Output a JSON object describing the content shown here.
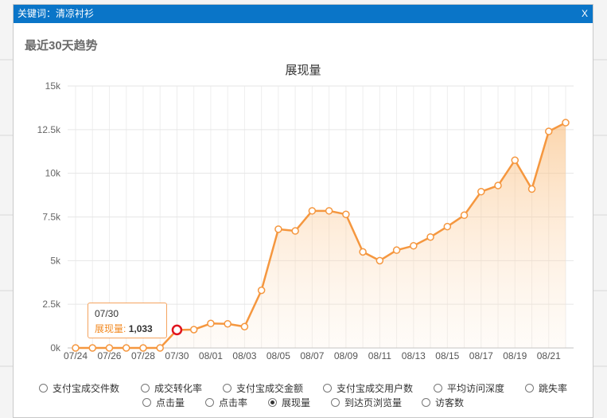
{
  "dialog": {
    "title": "关键词：清凉衬衫",
    "close_label": "X",
    "section_title": "最近30天趋势"
  },
  "tooltip": {
    "date": "07/30",
    "label": "展现量:",
    "value": "1,033"
  },
  "metrics_row1": [
    {
      "label": "支付宝成交件数",
      "selected": false
    },
    {
      "label": "成交转化率",
      "selected": false
    },
    {
      "label": "支付宝成交金额",
      "selected": false
    },
    {
      "label": "支付宝成交用户数",
      "selected": false
    },
    {
      "label": "平均访问深度",
      "selected": false
    },
    {
      "label": "跳失率",
      "selected": false
    }
  ],
  "metrics_row2": [
    {
      "label": "点击量",
      "selected": false
    },
    {
      "label": "点击率",
      "selected": false
    },
    {
      "label": "展现量",
      "selected": true
    },
    {
      "label": "到达页浏览量",
      "selected": false
    },
    {
      "label": "访客数",
      "selected": false
    }
  ],
  "colors": {
    "line": "#f5973f",
    "highlight": "#e0141e",
    "accent": "#0a75c8"
  },
  "chart_data": {
    "type": "area",
    "title": "展现量",
    "x": [
      "07/24",
      "07/25",
      "07/26",
      "07/27",
      "07/28",
      "07/29",
      "07/30",
      "07/31",
      "08/01",
      "08/02",
      "08/03",
      "08/04",
      "08/05",
      "08/06",
      "08/07",
      "08/08",
      "08/09",
      "08/10",
      "08/11",
      "08/12",
      "08/13",
      "08/14",
      "08/15",
      "08/16",
      "08/17",
      "08/18",
      "08/19",
      "08/20",
      "08/21",
      "08/22"
    ],
    "x_tick_labels": [
      "07/24",
      "07/26",
      "07/28",
      "07/30",
      "08/01",
      "08/03",
      "08/05",
      "08/07",
      "08/09",
      "08/11",
      "08/13",
      "08/15",
      "08/17",
      "08/19",
      "08/21"
    ],
    "series": [
      {
        "values": [
          0,
          0,
          0,
          0,
          0,
          0,
          1033,
          1050,
          1400,
          1380,
          1220,
          3300,
          6800,
          6700,
          7850,
          7850,
          7650,
          5500,
          5000,
          5600,
          5850,
          6350,
          6950,
          7600,
          8950,
          9300,
          10750,
          9100,
          12400,
          12900
        ]
      }
    ],
    "ylim": [
      0,
      15000
    ],
    "y_tick_labels": [
      "0k",
      "2.5k",
      "5k",
      "7.5k",
      "10k",
      "12.5k",
      "15k"
    ],
    "highlight_index": 6,
    "grid": true
  }
}
